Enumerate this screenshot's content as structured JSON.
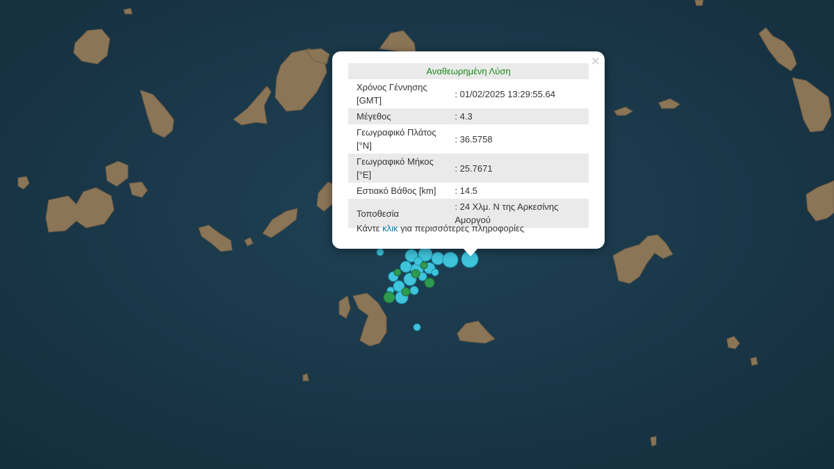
{
  "map": {
    "colors": {
      "sea": "#1b3a4b",
      "land": "#8b7557",
      "quake_primary": "#40c4dc",
      "quake_secondary": "#2e9a50"
    }
  },
  "popup": {
    "close_icon": "×",
    "title": "Αναθεωρημένη Λύση",
    "title_color": "#1a8a1a",
    "rows": [
      {
        "label": "Χρόνος Γέννησης [GMT]",
        "value": ": 01/02/2025 13:29:55.64"
      },
      {
        "label": "Μέγεθος",
        "value": ": 4.3"
      },
      {
        "label": "Γεωγραφικό Πλάτος [°N]",
        "value": ": 36.5758"
      },
      {
        "label": "Γεωγραφικό Μήκος [°E]",
        "value": ": 25.7671"
      },
      {
        "label": "Εστιακό Βάθος [km]",
        "value": ": 14.5"
      },
      {
        "label": "Τοποθεσία",
        "value": ": 24 Χλμ. N της Αρκεσίνης Αμοργού"
      }
    ],
    "more_prefix": "Κάντε",
    "more_link": "κλικ",
    "more_suffix": "για περισσότερες πληροφορίες"
  }
}
